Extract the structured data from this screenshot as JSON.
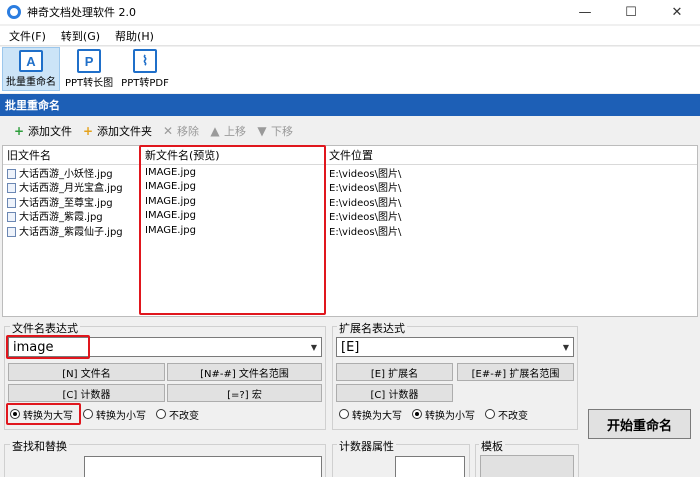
{
  "window": {
    "title": "神奇文档处理软件 2.0",
    "controls": {
      "minimize": "—",
      "maximize": "☐",
      "close": "✕"
    }
  },
  "menu": [
    "文件(F)",
    "转到(G)",
    "帮助(H)"
  ],
  "toolbar": [
    {
      "label": "批量重命名",
      "icon": "batch-rename-icon",
      "glyph": "A"
    },
    {
      "label": "PPT转长图",
      "icon": "ppt-icon",
      "glyph": "P"
    },
    {
      "label": "PPT转PDF",
      "icon": "pdf-icon",
      "glyph": "⌇"
    }
  ],
  "section_title": "批里重命名",
  "actions": [
    {
      "label": "添加文件",
      "icon": "add-file-icon",
      "glyph": "+",
      "color": "#2e9e3c"
    },
    {
      "label": "添加文件夹",
      "icon": "add-folder-icon",
      "glyph": "+",
      "color": "#e4a21c"
    },
    {
      "label": "移除",
      "icon": "remove-icon",
      "glyph": "✕",
      "color": "#9a9a9a"
    },
    {
      "label": "上移",
      "icon": "arrow-up-icon",
      "glyph": "▲",
      "color": "#9a9a9a"
    },
    {
      "label": "下移",
      "icon": "arrow-down-icon",
      "glyph": "▼",
      "color": "#9a9a9a"
    }
  ],
  "table": {
    "columns": [
      "旧文件名",
      "新文件名(预览)",
      "文件位置"
    ],
    "rows": [
      [
        "大话西游_小妖怪.jpg",
        "IMAGE.jpg",
        "E:\\videos\\图片\\"
      ],
      [
        "大话西游_月光宝盒.jpg",
        "IMAGE.jpg",
        "E:\\videos\\图片\\"
      ],
      [
        "大话西游_至尊宝.jpg",
        "IMAGE.jpg",
        "E:\\videos\\图片\\"
      ],
      [
        "大话西游_紫霞.jpg",
        "IMAGE.jpg",
        "E:\\videos\\图片\\"
      ],
      [
        "大话西游_紫霞仙子.jpg",
        "IMAGE.jpg",
        "E:\\videos\\图片\\"
      ]
    ]
  },
  "filename_expr": {
    "label": "文件名表达式",
    "value": "image",
    "buttons": [
      "[N] 文件名",
      "[N#-#] 文件名范围",
      "[C] 计数器",
      "[=?] 宏"
    ],
    "case_options": [
      "转换为大写",
      "转换为小写",
      "不改变"
    ],
    "case_selected": 0
  },
  "ext_expr": {
    "label": "扩展名表达式",
    "value": "[E]",
    "buttons": [
      "[E] 扩展名",
      "[E#-#] 扩展名范围",
      "[C] 计数器"
    ],
    "case_options": [
      "转换为大写",
      "转换为小写",
      "不改变"
    ],
    "case_selected": 1
  },
  "start_button": "开始重命名",
  "bottom": {
    "find_replace": "查找和替换",
    "counter_props": "计数器属性",
    "template": "模板"
  },
  "colors": {
    "accent": "#1d5fb6",
    "highlight": "#e0161d"
  }
}
